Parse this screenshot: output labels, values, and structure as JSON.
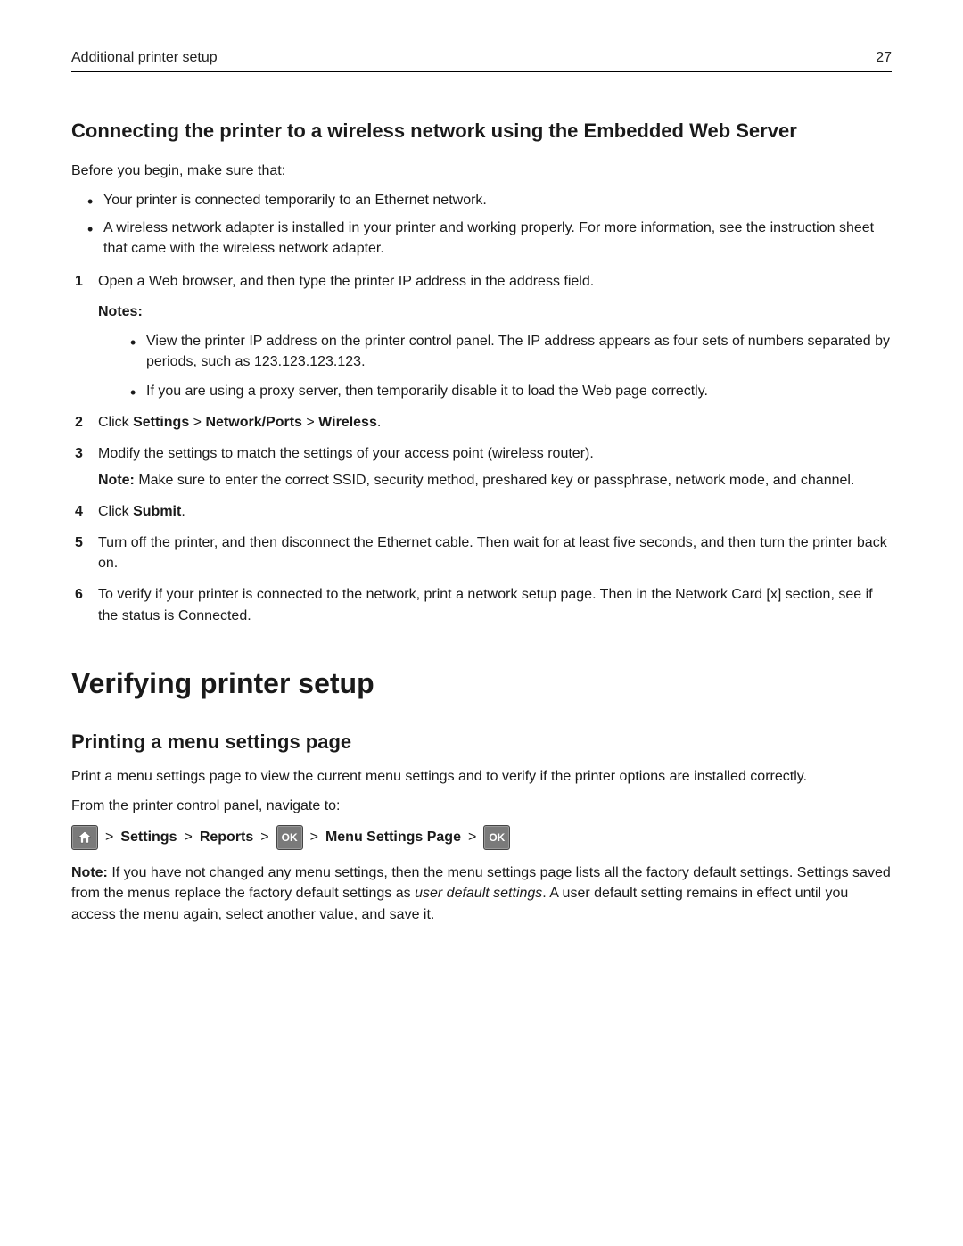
{
  "header": {
    "title": "Additional printer setup",
    "page_number": "27"
  },
  "section1": {
    "heading": "Connecting the printer to a wireless network using the Embedded Web Server",
    "intro": "Before you begin, make sure that:",
    "pre_bullets": [
      "Your printer is connected temporarily to an Ethernet network.",
      "A wireless network adapter is installed in your printer and working properly. For more information, see the instruction sheet that came with the wireless network adapter."
    ],
    "steps": {
      "s1": {
        "num": "1",
        "text": "Open a Web browser, and then type the printer IP address in the address field.",
        "notes_label": "Notes:",
        "notes": [
          "View the printer IP address on the printer control panel. The IP address appears as four sets of numbers separated by periods, such as 123.123.123.123.",
          "If you are using a proxy server, then temporarily disable it to load the Web page correctly."
        ]
      },
      "s2": {
        "num": "2",
        "prefix": "Click ",
        "seg1": "Settings",
        "sep": " > ",
        "seg2": "Network/Ports",
        "seg3": "Wireless",
        "suffix": "."
      },
      "s3": {
        "num": "3",
        "text": "Modify the settings to match the settings of your access point (wireless router).",
        "note_label": "Note: ",
        "note_text": "Make sure to enter the correct SSID, security method, preshared key or passphrase, network mode, and channel."
      },
      "s4": {
        "num": "4",
        "prefix": "Click ",
        "seg1": "Submit",
        "suffix": "."
      },
      "s5": {
        "num": "5",
        "text": "Turn off the printer, and then disconnect the Ethernet cable. Then wait for at least five seconds, and then turn the printer back on."
      },
      "s6": {
        "num": "6",
        "text": "To verify if your printer is connected to the network, print a network setup page. Then in the Network Card [x] section, see if the status is Connected."
      }
    }
  },
  "section2": {
    "heading": "Verifying printer setup",
    "sub_heading": "Printing a menu settings page",
    "p1": "Print a menu settings page to view the current menu settings and to verify if the printer options are installed correctly.",
    "p2": "From the printer control panel, navigate to:",
    "nav": {
      "gt": ">",
      "settings": "Settings",
      "reports": "Reports",
      "menu_settings_page": "Menu Settings Page",
      "ok_label": "OK"
    },
    "note_label": "Note: ",
    "note_text1": "If you have not changed any menu settings, then the menu settings page lists all the factory default settings. Settings saved from the menus replace the factory default settings as ",
    "note_italic": "user default settings",
    "note_text2": ". A user default setting remains in effect until you access the menu again, select another value, and save it."
  }
}
